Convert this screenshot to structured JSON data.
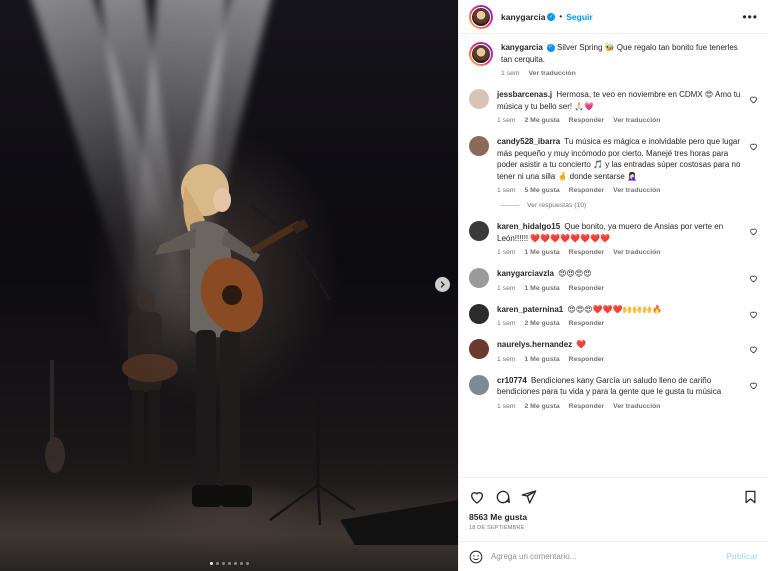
{
  "post": {
    "username": "kanygarcia",
    "separator": "•",
    "follow_label": "Seguir",
    "more_label": "•••",
    "caption": {
      "username": "kanygarcia",
      "text": "Silver Spring 🐝 Que regalo tan bonito fue tenerles tan cerquita.",
      "time": "1 sem",
      "translate": "Ver traducción"
    },
    "likes": "8563 Me gusta",
    "date": "18 de septiembre",
    "add_comment_placeholder": "Agrega un comentario...",
    "publish_label": "Publicar",
    "carousel": {
      "slides": 7,
      "active": 1
    }
  },
  "comments": [
    {
      "user": "jessbarcenas.j",
      "text": "Hermosa, te veo en noviembre en CDMX 😍 Amo tu música y tu bello ser! 🙏🏻💗",
      "time": "1 sem",
      "likes": "2 Me gusta",
      "reply": "Responder",
      "translate": "Ver traducción",
      "avatar_color": "#d8c4b6"
    },
    {
      "user": "candy528_ibarra",
      "text": "Tu música es mágica e inolvidable pero que lugar más pequeño y muy incómodo por cierto. Manejé tres horas para poder asistir a tu concierto 🎵 y las entradas súper costosas para no tener ni una silla 🤞 donde sentarse 🤦🏻‍♀️",
      "time": "1 sem",
      "likes": "5 Me gusta",
      "reply": "Responder",
      "translate": "Ver traducción",
      "avatar_color": "#8a6b58",
      "replies_label": "Ver respuestas (10)"
    },
    {
      "user": "karen_hidalgo15",
      "text": "Que bonito, ya muero de Ansias por verte en León!!!!!! ❤️❤️❤️❤️❤️❤️❤️❤️",
      "time": "1 sem",
      "likes": "1 Me gusta",
      "reply": "Responder",
      "translate": "Ver traducción",
      "avatar_color": "#3a3a3a"
    },
    {
      "user": "kanygarciavzla",
      "text": "😍😍😍😍",
      "time": "1 sem",
      "likes": "1 Me gusta",
      "reply": "Responder",
      "avatar_color": "#9a9a9a"
    },
    {
      "user": "karen_paternina1",
      "text": "😍😍😍❤️❤️❤️🙌🙌🙌🔥",
      "time": "1 sem",
      "likes": "2 Me gusta",
      "reply": "Responder",
      "avatar_color": "#2b2b2b"
    },
    {
      "user": "naurelys.hernandez",
      "text": "❤️",
      "time": "1 sem",
      "likes": "1 Me gusta",
      "reply": "Responder",
      "avatar_color": "#6b3a2e"
    },
    {
      "user": "cr10774",
      "text": "Bendiciones kany García un saludo lleno de cariño bendiciones para tu vida y para la gente que le gusta tu música",
      "time": "1 sem",
      "likes": "2 Me gusta",
      "reply": "Responder",
      "translate": "Ver traducción",
      "avatar_color": "#7d8a95"
    }
  ],
  "icons": {
    "like": "heart-icon",
    "comment": "comment-icon",
    "share": "share-icon",
    "save": "bookmark-icon",
    "next": "chevron-right-icon",
    "emoji": "emoji-icon"
  },
  "colors": {
    "accent": "#0095f6",
    "text": "#262626",
    "muted": "#737373",
    "publish_disabled": "#b2dffc"
  }
}
